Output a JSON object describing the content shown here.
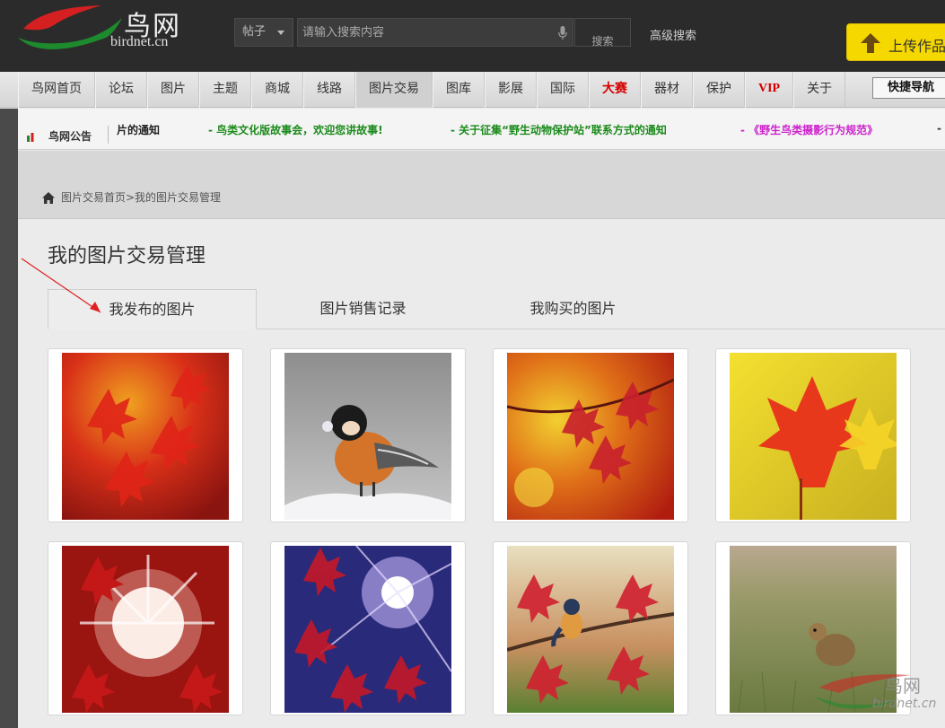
{
  "header": {
    "logo_text": "鸟网",
    "logo_domain": "birdnet.cn",
    "search_type": "帖子",
    "search_placeholder": "请输入搜索内容",
    "search_button": "搜索",
    "advanced_search": "高级搜索",
    "upload_label": "上传作品"
  },
  "nav": {
    "items": [
      "鸟网首页",
      "论坛",
      "图片",
      "主题",
      "商城",
      "线路",
      "图片交易",
      "图库",
      "影展",
      "国际",
      "大赛",
      "器材",
      "保护",
      "VIP",
      "关于"
    ],
    "active": "图片交易",
    "quick_nav": "快捷导航"
  },
  "notice": {
    "title": "鸟网公告",
    "items": [
      {
        "text": "片的通知",
        "color": "#222222"
      },
      {
        "text": "- 鸟类文化版故事会，欢迎您讲故事!",
        "color": "#1a8a1a"
      },
      {
        "text": "- 关于征集“野生动物保护站”联系方式的通知",
        "color": "#1a8a1a"
      },
      {
        "text": "- 《野生鸟类摄影行为规范》",
        "color": "#cc22cc"
      },
      {
        "text": "-",
        "color": "#333333"
      }
    ]
  },
  "breadcrumb": "图片交易首页>我的图片交易管理",
  "page_title": "我的图片交易管理",
  "tabs": [
    "我发布的图片",
    "图片销售记录",
    "我购买的图片"
  ],
  "active_tab": "我发布的图片",
  "thumbnails": [
    {
      "name": "red-maple-leaves"
    },
    {
      "name": "tit-bird-on-snow"
    },
    {
      "name": "autumn-leaves-branch"
    },
    {
      "name": "red-yellow-maple"
    },
    {
      "name": "red-leaves-sunburst"
    },
    {
      "name": "red-leaves-blue-sky-sun"
    },
    {
      "name": "bird-on-red-leaf-branch"
    },
    {
      "name": "ground-squirrel-grass"
    }
  ],
  "watermark": {
    "text": "鸟网",
    "domain": "birdnet.cn"
  },
  "colors": {
    "header_bg": "#2b2b2b",
    "upload_yellow": "#f5d800",
    "nav_red": "#d40000",
    "notice_green": "#1a8a1a",
    "notice_magenta": "#cc22cc"
  }
}
